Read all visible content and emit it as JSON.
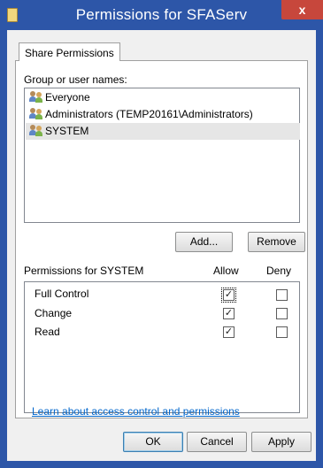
{
  "window": {
    "title": "Permissions for SFAServ",
    "close_label": "x"
  },
  "tab": {
    "label": "Share Permissions"
  },
  "groups": {
    "label": "Group or user names:",
    "items": [
      {
        "name": "Everyone",
        "icon": "users-icon",
        "selected": false
      },
      {
        "name": "Administrators (TEMP20161\\Administrators)",
        "icon": "users-icon",
        "selected": false
      },
      {
        "name": "SYSTEM",
        "icon": "users-icon",
        "selected": true
      }
    ],
    "add_label": "Add...",
    "remove_label": "Remove"
  },
  "permissions": {
    "label": "Permissions for SYSTEM",
    "allow_header": "Allow",
    "deny_header": "Deny",
    "rows": [
      {
        "name": "Full Control",
        "allow": true,
        "deny": false
      },
      {
        "name": "Change",
        "allow": true,
        "deny": false
      },
      {
        "name": "Read",
        "allow": true,
        "deny": false
      }
    ]
  },
  "help_link": "Learn about access control and permissions",
  "footer": {
    "ok_label": "OK",
    "cancel_label": "Cancel",
    "apply_label": "Apply"
  },
  "colors": {
    "titlebar": "#2d56a8",
    "close": "#c7473c",
    "link": "#0066cc"
  }
}
